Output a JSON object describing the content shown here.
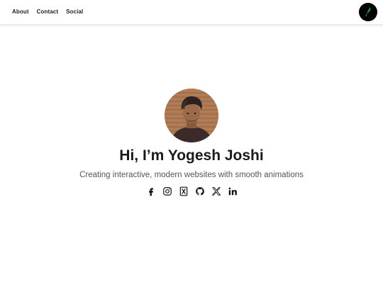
{
  "nav": {
    "links": [
      "About",
      "Contact",
      "Social"
    ]
  },
  "theme_toggle": {
    "icon": "leaf-icon"
  },
  "hero": {
    "avatar_icon": "profile-photo",
    "title": "Hi, I’m Yogesh Joshi",
    "subtitle": "Creating interactive, modern websites with smooth animations"
  },
  "socials": [
    "facebook-icon",
    "instagram-icon",
    "xing-icon",
    "github-icon",
    "x-icon",
    "linkedin-icon"
  ],
  "colors": {
    "background": "#ffffff",
    "title": "#1a1a1a",
    "subtitle": "#555555",
    "toggle": "#000000"
  }
}
